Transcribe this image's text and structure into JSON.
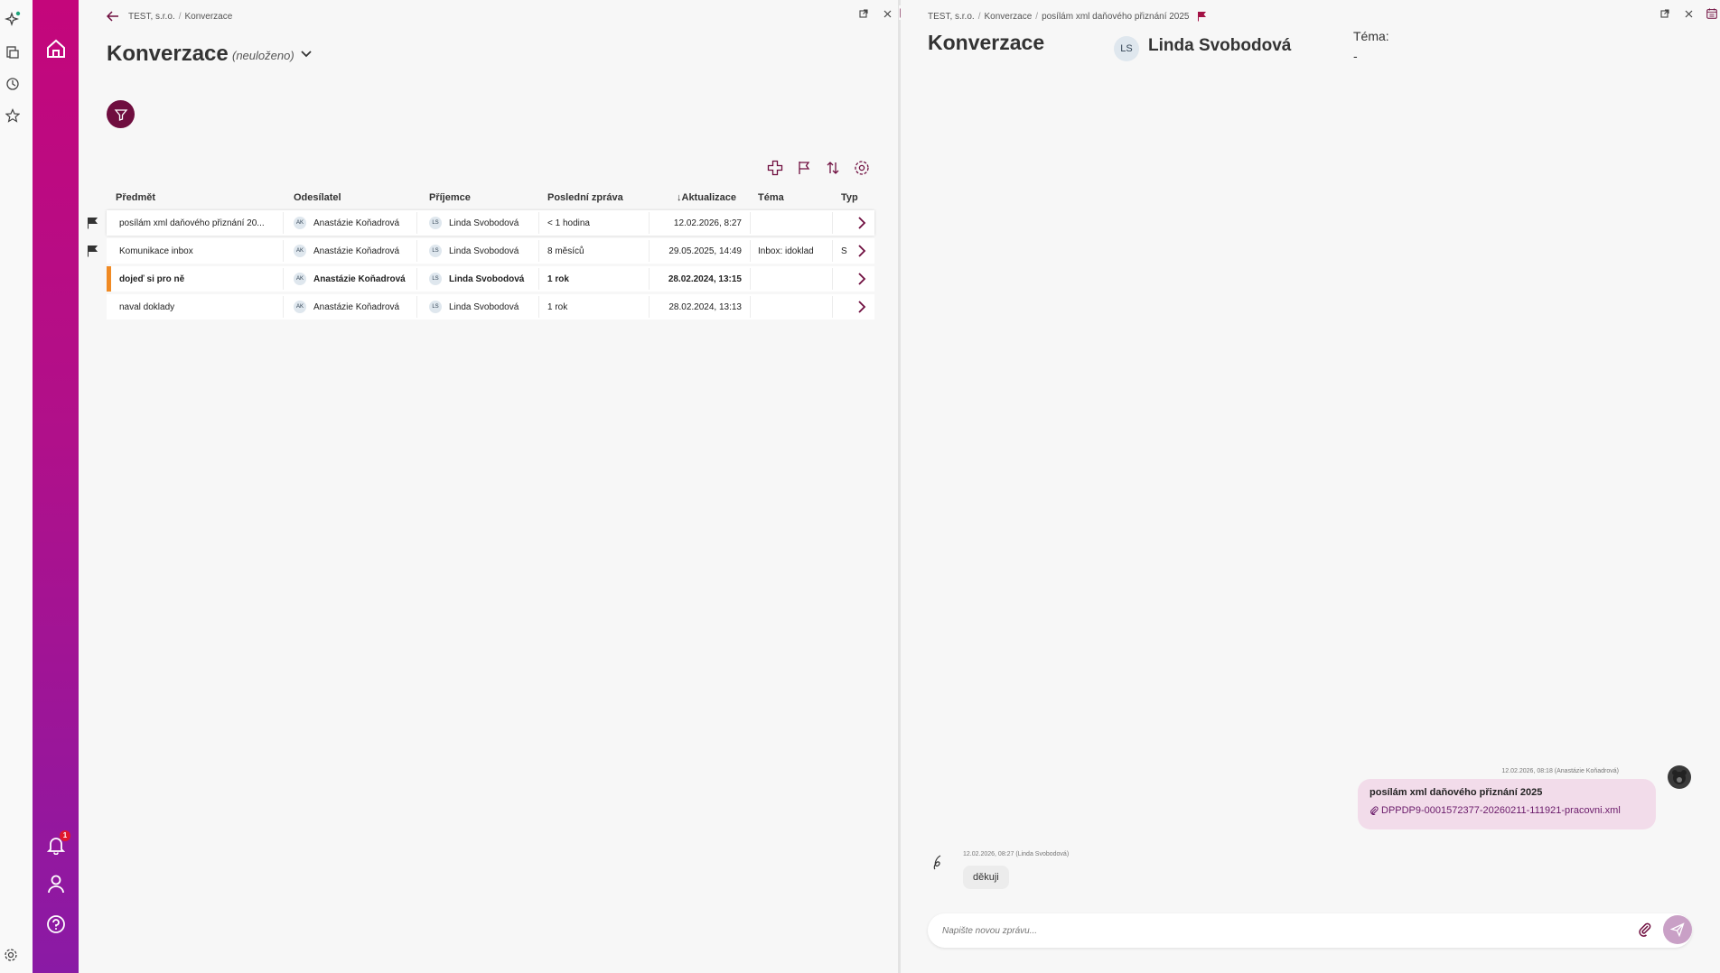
{
  "colors": {
    "brand": "#c4067b",
    "brand_dark": "#6f0e3f",
    "accent_orange": "#f08a24",
    "bubble_out": "#f2dcea"
  },
  "sidebar": {
    "notification_count": "1"
  },
  "left": {
    "breadcrumb": [
      "TEST, s.r.o.",
      "Konverzace"
    ],
    "title": "Konverzace",
    "unsaved_label": "(neuloženo)",
    "columns": [
      "Předmět",
      "Odesílatel",
      "Příjemce",
      "Poslední zpráva",
      "Aktualizace",
      "Téma",
      "Typ"
    ],
    "rows": [
      {
        "subject": "posílám xml daňového přiznání 20...",
        "sender_initials": "AK",
        "sender": "Anastázie Koňadrová",
        "recipient_initials": "LS",
        "recipient": "Linda Svobodová",
        "last": "< 1 hodina",
        "updated": "12.02.2026, 8:27",
        "topic": "",
        "type": ""
      },
      {
        "subject": "Komunikace inbox",
        "sender_initials": "AK",
        "sender": "Anastázie Koňadrová",
        "recipient_initials": "LS",
        "recipient": "Linda Svobodová",
        "last": "8 měsíců",
        "updated": "29.05.2025, 14:49",
        "topic": "Inbox: idoklad",
        "type": "S"
      },
      {
        "subject": "dojeď si pro ně",
        "sender_initials": "AK",
        "sender": "Anastázie Koňadrová",
        "recipient_initials": "LS",
        "recipient": "Linda Svobodová",
        "last": "1 rok",
        "updated": "28.02.2024, 13:15",
        "topic": "",
        "type": ""
      },
      {
        "subject": "naval doklady",
        "sender_initials": "AK",
        "sender": "Anastázie Koňadrová",
        "recipient_initials": "LS",
        "recipient": "Linda Svobodová",
        "last": "1 rok",
        "updated": "28.02.2024, 13:13",
        "topic": "",
        "type": ""
      }
    ]
  },
  "right": {
    "breadcrumb": [
      "TEST, s.r.o.",
      "Konverzace",
      "posílám xml daňového přiznání 2025"
    ],
    "title": "Konverzace",
    "contact_initials": "LS",
    "contact_name": "Linda Svobodová",
    "topic_label": "Téma:",
    "topic_value": "-",
    "messages": [
      {
        "meta": "12.02.2026, 08:18 (Anastázie Koňadrová)",
        "text": "posílám xml daňového přiznání 2025",
        "attachment": "DPPDP9-0001572377-20260211-111921-pracovni.xml"
      },
      {
        "meta": "12.02.2026, 08:27 (Linda Svobodová)",
        "text": "děkuji"
      }
    ],
    "compose_placeholder": "Napište novou zprávu..."
  }
}
